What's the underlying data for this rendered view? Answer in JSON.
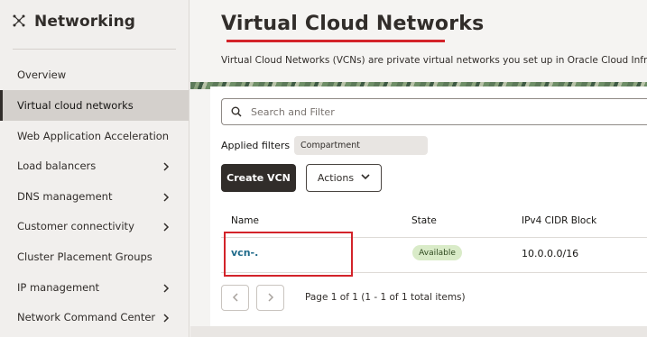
{
  "sidebar": {
    "title": "Networking",
    "icon": "network-icon",
    "items": [
      {
        "label": "Overview",
        "has_submenu": false
      },
      {
        "label": "Virtual cloud networks",
        "has_submenu": false,
        "active": true
      },
      {
        "label": "Web Application Acceleration",
        "has_submenu": false
      },
      {
        "label": "Load balancers",
        "has_submenu": true
      },
      {
        "label": "DNS management",
        "has_submenu": true
      },
      {
        "label": "Customer connectivity",
        "has_submenu": true
      },
      {
        "label": "Cluster Placement Groups",
        "has_submenu": false
      },
      {
        "label": "IP management",
        "has_submenu": true
      },
      {
        "label": "Network Command Center",
        "has_submenu": true
      }
    ]
  },
  "main": {
    "title": "Virtual Cloud Networks",
    "description": "Virtual Cloud Networks (VCNs) are private virtual networks you set up in Oracle Cloud Infrastru",
    "search": {
      "placeholder": "Search and Filter",
      "value": ""
    },
    "filters": {
      "label": "Applied filters",
      "chip": "Compartment"
    },
    "buttons": {
      "create": "Create VCN",
      "actions": "Actions"
    },
    "table": {
      "columns": [
        "Name",
        "State",
        "IPv4 CIDR Block"
      ],
      "rows": [
        {
          "name": "vcn-.",
          "state": "Available",
          "cidr": "10.0.0.0/16"
        }
      ]
    },
    "pagination": {
      "text": "Page 1 of 1 (1 - 1 of 1 total items)"
    }
  },
  "colors": {
    "accent_dark": "#312d2a",
    "link": "#1f6a8a",
    "annotation_red": "#d3232a",
    "badge_bg": "#d9ebc8"
  }
}
